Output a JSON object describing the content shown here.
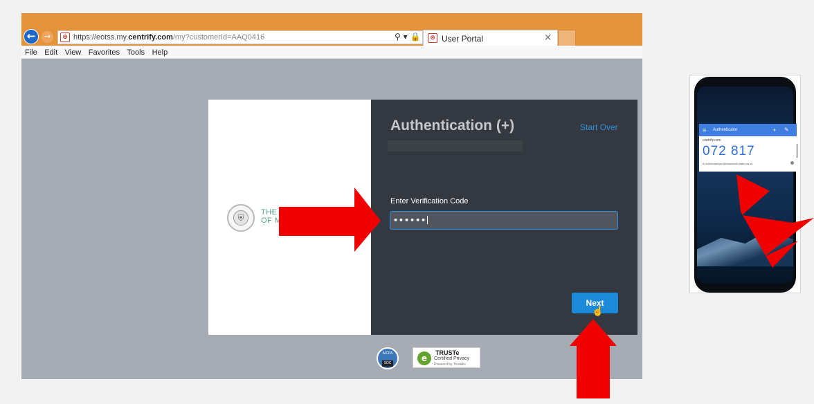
{
  "browser": {
    "url_scheme": "https://eotss.my.",
    "url_domain": "centrify.com",
    "url_path": "/my?customerId=AAQ0416",
    "favicon_glyph": "⊛",
    "address_icons": "⚲ ▾ 🔒 ↻",
    "tab_title": "User Portal",
    "tab_close": "×",
    "back_glyph": "←",
    "forward_glyph": "→",
    "menu": [
      "File",
      "Edit",
      "View",
      "Favorites",
      "Tools",
      "Help"
    ]
  },
  "login": {
    "seal_text_line1": "THE",
    "seal_text_line2": "OF M",
    "title": "Authentication (+)",
    "start_over": "Start Over",
    "code_label": "Enter Verification Code",
    "code_value": "••••••",
    "next_label": "Next",
    "cursor_glyph": "☝"
  },
  "badges": {
    "aicpa_top": "AICPA",
    "aicpa_soc": "SOC",
    "truste_name": "TRUSTe",
    "truste_sub": "Certified Privacy",
    "truste_powered": "Powered by TrustArc",
    "truste_glyph": "e"
  },
  "phone": {
    "app_name": "Authenticator",
    "menu_glyph": "≡",
    "plus_glyph": "+",
    "edit_glyph": "✎",
    "issuer": "centrify.com",
    "code": "072 817",
    "account": "rk.subramaniyan@massmail.state.ma.us"
  },
  "colors": {
    "browser_bar": "#e5933a",
    "panel_dark": "#343941",
    "accent_blue": "#1c8ad9",
    "arrow_red": "#f00000"
  }
}
